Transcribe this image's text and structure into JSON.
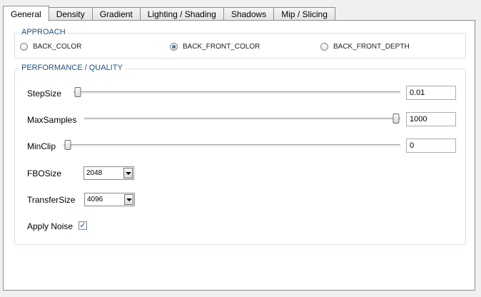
{
  "tabs": [
    {
      "label": "General",
      "active": true
    },
    {
      "label": "Density"
    },
    {
      "label": "Gradient"
    },
    {
      "label": "Lighting / Shading"
    },
    {
      "label": "Shadows"
    },
    {
      "label": "Mip / Slicing"
    }
  ],
  "approach": {
    "title": "APPROACH",
    "options": [
      {
        "label": "BACK_COLOR",
        "selected": false
      },
      {
        "label": "BACK_FRONT_COLOR",
        "selected": true
      },
      {
        "label": "BACK_FRONT_DEPTH",
        "selected": false
      }
    ]
  },
  "performance": {
    "title": "PERFORMANCE / QUALITY",
    "step_size": {
      "label": "StepSize",
      "value": "0.01",
      "slider_fraction": 0.0
    },
    "max_samples": {
      "label": "MaxSamples",
      "value": "1000",
      "slider_fraction": 1.0
    },
    "min_clip": {
      "label": "MinClip",
      "value": "0",
      "slider_fraction": 0.0
    },
    "fbo_size": {
      "label": "FBOSize",
      "value": "2048"
    },
    "transfer_size": {
      "label": "TransferSize",
      "value": "4096"
    },
    "apply_noise": {
      "label": "Apply Noise",
      "checked": true,
      "check_glyph": "✓"
    }
  }
}
